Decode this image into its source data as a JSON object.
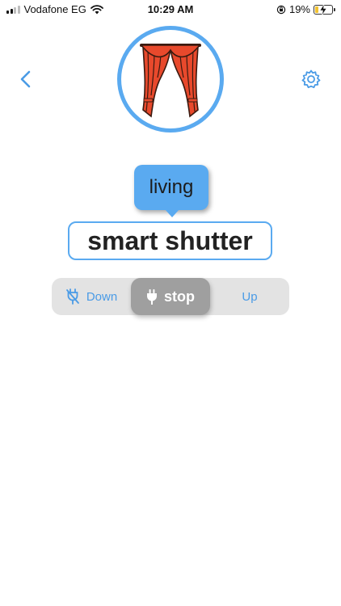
{
  "status_bar": {
    "carrier": "Vodafone EG",
    "time": "10:29 AM",
    "battery": "19%",
    "battery_level": 0.19
  },
  "header": {
    "back_icon": "chevron-left-icon",
    "settings_icon": "gear-icon",
    "device_image": "curtain-icon"
  },
  "device": {
    "room": "living",
    "name": "smart shutter"
  },
  "controls": {
    "down_label": "Down",
    "stop_label": "stop",
    "up_label": "Up",
    "selected": "stop"
  },
  "colors": {
    "accent": "#5aaaf0",
    "selected_segment": "#9f9f9f",
    "segment_bg": "#e3e3e3",
    "curtain": "#e8492c"
  }
}
